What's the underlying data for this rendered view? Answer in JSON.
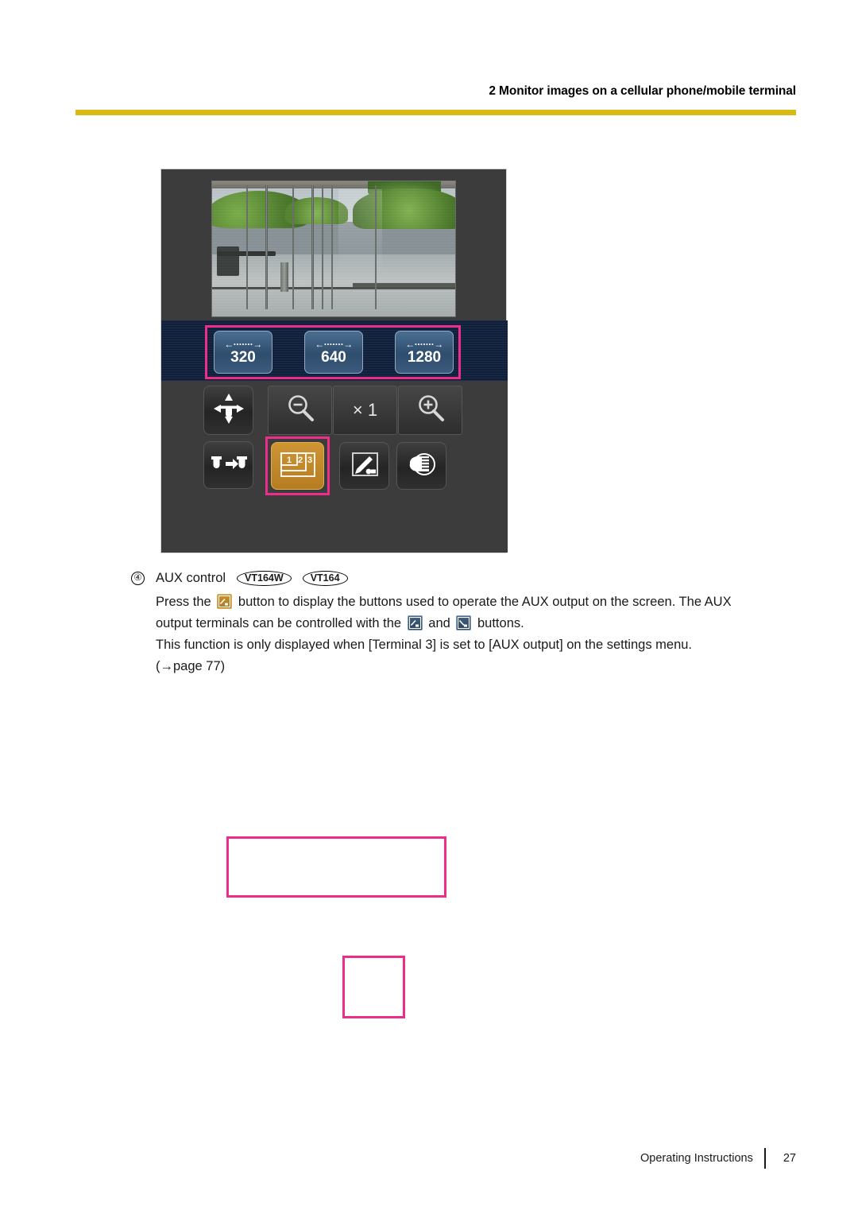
{
  "header": {
    "title": "2 Monitor images on a cellular phone/mobile terminal",
    "rule_color": "#d7bb12"
  },
  "device_screenshot": {
    "camera_view_alt": "live camera view of a glass entrance with hedges",
    "resolution_bar": {
      "highlighted": true,
      "highlight_color": "#ec2d8a",
      "buttons": [
        {
          "arrow": "←·······→",
          "label": "320"
        },
        {
          "arrow": "←·······→",
          "label": "640"
        },
        {
          "arrow": "←·······→",
          "label": "1280"
        }
      ]
    },
    "control_row_1": [
      {
        "name": "pan-tilt-pad",
        "icon": "pan-tilt-icon",
        "label": ""
      },
      {
        "name": "zoom-out-button",
        "icon": "zoom-out-icon",
        "label": ""
      },
      {
        "name": "zoom-level-button",
        "icon": "zoom-level-icon",
        "label": "× 1"
      },
      {
        "name": "zoom-in-button",
        "icon": "zoom-in-icon",
        "label": ""
      }
    ],
    "control_row_2": [
      {
        "name": "preset-move-button",
        "icon": "preset-move-icon",
        "label": ""
      },
      {
        "name": "aux-control-button",
        "icon": "aux-control-icon",
        "label": "",
        "state": "selected",
        "highlighted": true
      },
      {
        "name": "brightness-button",
        "icon": "brightness-icon",
        "label": ""
      },
      {
        "name": "wiper-button",
        "icon": "wiper-icon",
        "label": ""
      }
    ],
    "aux_icon_numbers": [
      "1",
      "2",
      "3"
    ]
  },
  "body": {
    "item_number": "④",
    "item_title": "AUX control",
    "model_badges": [
      "VT164W",
      "VT164"
    ],
    "para_1_before": "Press the",
    "para_1_after": "button to display the buttons used to operate the AUX output on the screen. The AUX",
    "para_2_before": "output terminals can be controlled with the",
    "para_2_middle": "and",
    "para_2_after": "buttons.",
    "para_3": "This function is only displayed when [Terminal 3] is set to [AUX output] on the settings menu.",
    "para_4": "(→page 77)"
  },
  "annotations": {
    "box_wide_color": "#ec2d8a",
    "box_small_color": "#ec2d8a"
  },
  "footer": {
    "label": "Operating Instructions",
    "page": "27"
  }
}
